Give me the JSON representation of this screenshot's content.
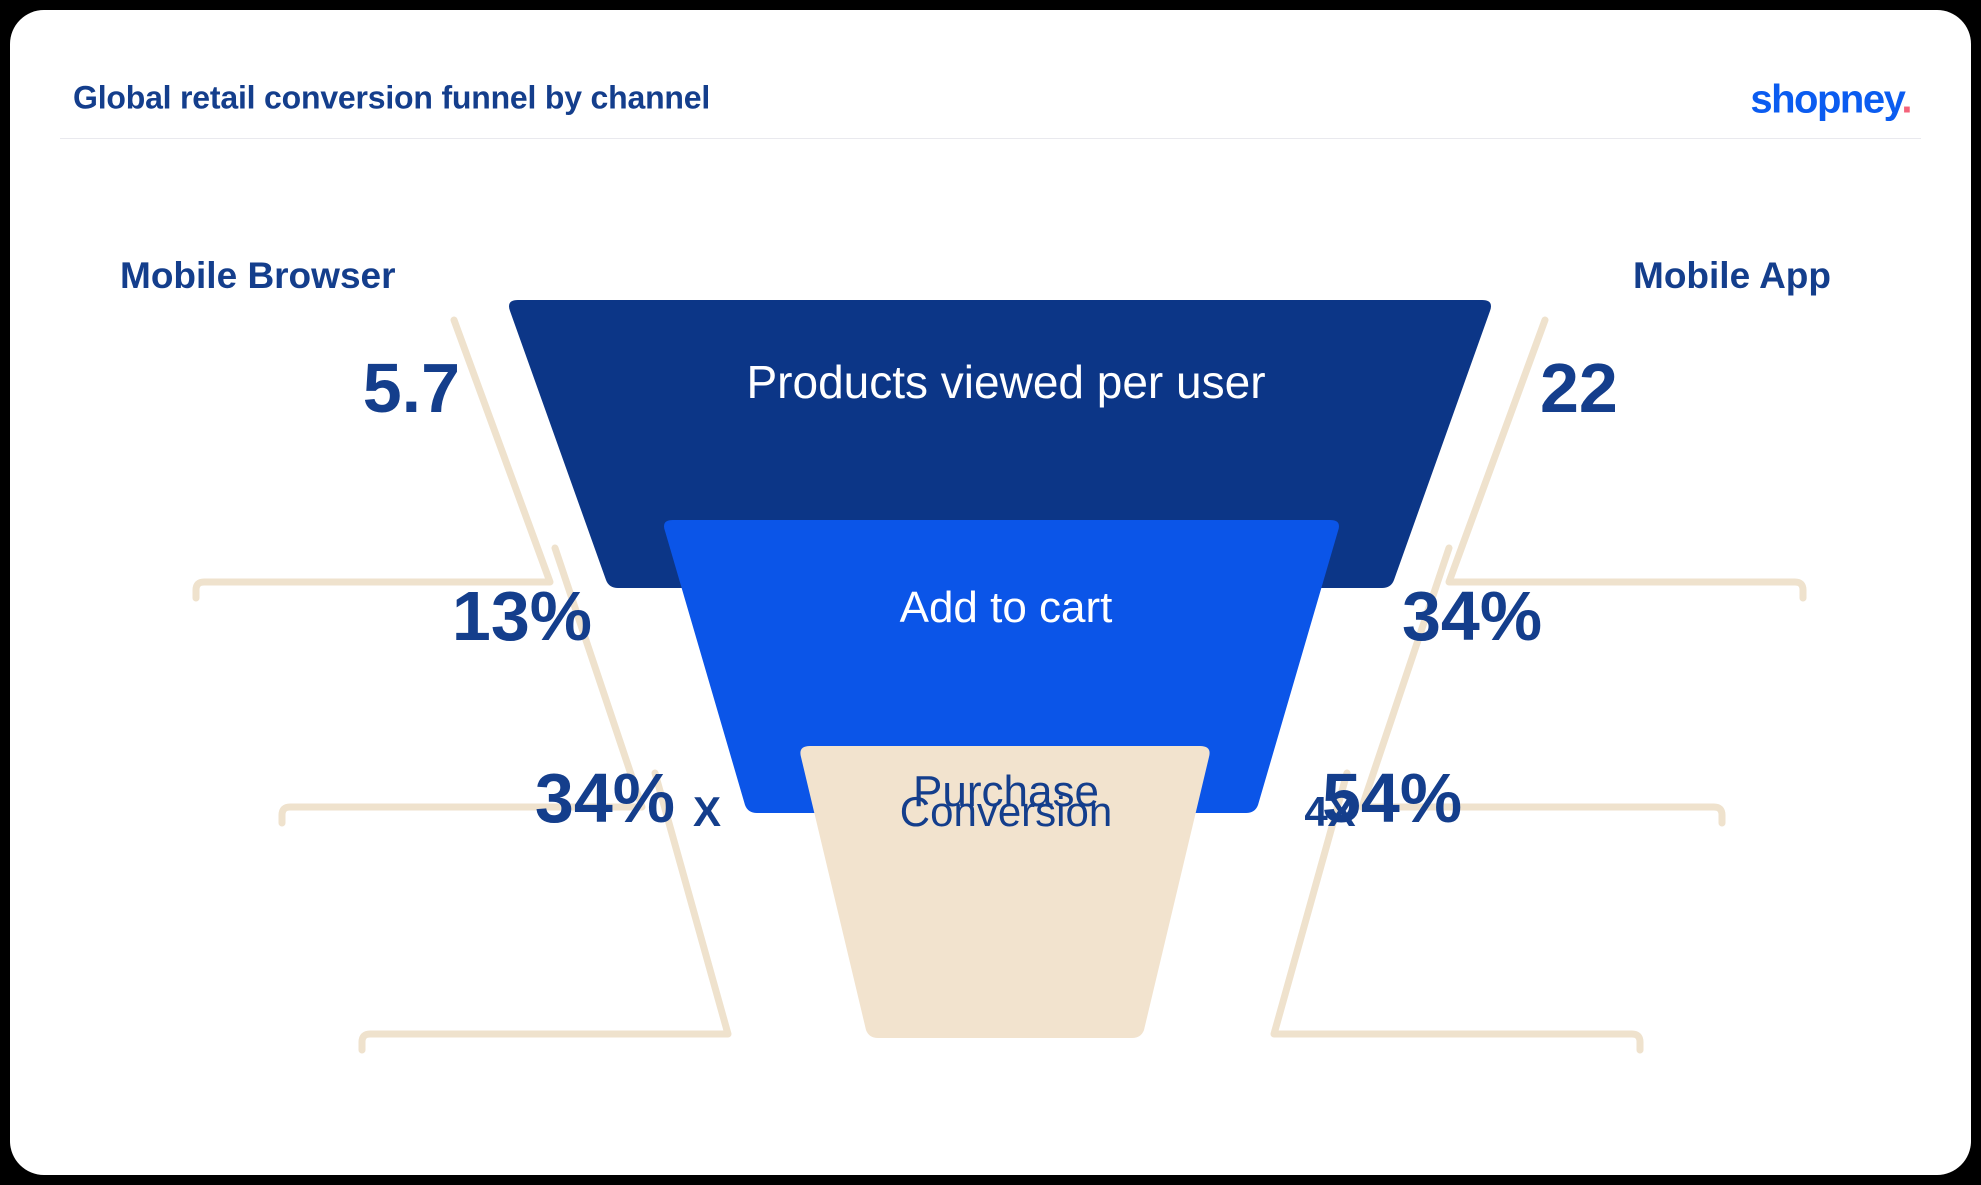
{
  "header": {
    "title": "Global retail conversion funnel by channel",
    "brand": "shopney",
    "brand_dot": "."
  },
  "funnel": {
    "left_channel": "Mobile Browser",
    "right_channel": "Mobile App",
    "stages": [
      {
        "label": "Products viewed per user",
        "left_value": "5.7",
        "right_value": "22",
        "fill": "#0C3687",
        "text_color": "#FFFFFF"
      },
      {
        "label": "Add to cart",
        "left_value": "13%",
        "right_value": "34%",
        "fill": "#0B55E8",
        "text_color": "#FFFFFF"
      },
      {
        "label": "Purchase",
        "left_value": "34%",
        "right_value": "54%",
        "fill": "#F2E3CE",
        "text_color": "#143E8C"
      }
    ],
    "footer": {
      "left": "X",
      "center": "Conversion",
      "right": "4X"
    }
  },
  "colors": {
    "brand_blue": "#0B5CF0",
    "brand_dot_pink": "#F4637A",
    "navy": "#143E8C",
    "deep_navy": "#0C3687",
    "bright_blue": "#0B55E8",
    "beige": "#F2E3CE",
    "beige_outline": "#EFE2CD",
    "card_bg": "#FFFFFF",
    "page_bg": "#000000"
  },
  "chart_data": {
    "type": "funnel",
    "title": "Global retail conversion funnel by channel",
    "series": [
      {
        "name": "Mobile Browser",
        "values": [
          "5.7",
          "13%",
          "34%"
        ],
        "conversion": "X"
      },
      {
        "name": "Mobile App",
        "values": [
          "22",
          "34%",
          "54%"
        ],
        "conversion": "4X"
      }
    ],
    "categories": [
      "Products viewed per user",
      "Add to cart",
      "Purchase"
    ],
    "xlabel": "",
    "ylabel": "",
    "legend": [
      "Mobile Browser",
      "Mobile App"
    ],
    "annotations": [
      "Conversion"
    ]
  }
}
